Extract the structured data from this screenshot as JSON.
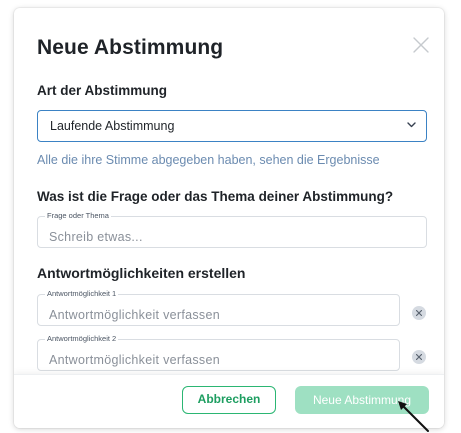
{
  "modal": {
    "title": "Neue Abstimmung",
    "close_icon": "close-icon"
  },
  "poll_type": {
    "label": "Art der Abstimmung",
    "selected": "Laufende Abstimmung",
    "hint": "Alle die ihre Stimme abgegeben haben, sehen die Ergebnisse"
  },
  "question": {
    "label": "Was ist die Frage oder das Thema deiner Abstimmung?",
    "field_legend": "Frage oder Thema",
    "placeholder": "Schreib etwas...",
    "value": ""
  },
  "answers": {
    "label": "Antwortmöglichkeiten erstellen",
    "items": [
      {
        "legend": "Antwortmöglichkeit 1",
        "placeholder": "Antwortmöglichkeit verfassen",
        "value": ""
      },
      {
        "legend": "Antwortmöglichkeit 2",
        "placeholder": "Antwortmöglichkeit verfassen",
        "value": ""
      }
    ]
  },
  "footer": {
    "cancel_label": "Abbrechen",
    "create_label": "Neue Abstimmung",
    "create_enabled": false
  },
  "colors": {
    "accent_green": "#2bb673",
    "disabled_green": "#9ee0c2",
    "focus_blue": "#3b82c4",
    "hint_blue": "#6b8bb0"
  }
}
